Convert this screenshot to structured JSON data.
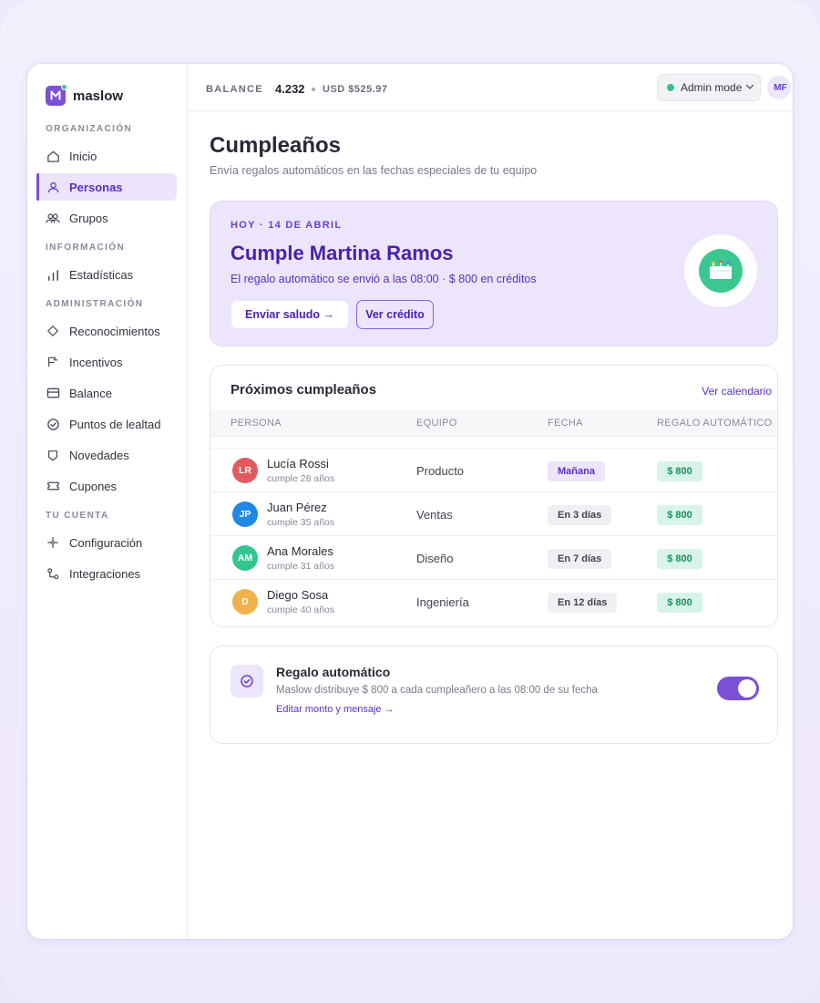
{
  "brand": {
    "name": "maslow",
    "accent": "#7b4fd6"
  },
  "sidebar": {
    "sections": [
      {
        "label": "ORGANIZACIÓN"
      },
      {
        "label": "INFORMACIÓN"
      },
      {
        "label": "ADMINISTRACIÓN"
      },
      {
        "label": "TU CUENTA"
      }
    ],
    "items": [
      {
        "label": "Inicio",
        "icon": "home-icon"
      },
      {
        "label": "Personas",
        "icon": "user-icon",
        "active": true
      },
      {
        "label": "Grupos",
        "icon": "users-icon"
      },
      {
        "label": "Estadísticas",
        "icon": "bar-chart-icon"
      },
      {
        "label": "Reconocimientos",
        "icon": "diamond-icon"
      },
      {
        "label": "Incentivos",
        "icon": "flag-icon"
      },
      {
        "label": "Balance",
        "icon": "card-icon"
      },
      {
        "label": "Puntos de lealtad",
        "icon": "check-circle-icon"
      },
      {
        "label": "Novedades",
        "icon": "shield-icon"
      },
      {
        "label": "Cupones",
        "icon": "ticket-icon"
      },
      {
        "label": "Configuración",
        "icon": "sparkle-icon"
      },
      {
        "label": "Integraciones",
        "icon": "integrations-icon"
      }
    ]
  },
  "topbar": {
    "balance_label": "BALANCE",
    "balance_value": "4.232",
    "balance_usd": "USD $525.97",
    "admin_label": "Admin mode",
    "user_initials": "MF"
  },
  "page": {
    "title": "Cumpleaños",
    "subtitle": "Envía regalos automáticos en las fechas especiales de tu equipo"
  },
  "hero": {
    "date": "HOY · 14 DE ABRIL",
    "title": "Cumple Martina Ramos",
    "desc": "El regalo automático se envió a las 08:00 · $ 800 en créditos",
    "primary_btn": "Enviar saludo →",
    "secondary_btn": "Ver crédito"
  },
  "upcoming": {
    "title": "Próximos cumpleaños",
    "link": "Ver calendario",
    "columns": [
      "PERSONA",
      "EQUIPO",
      "FECHA",
      "REGALO AUTOMÁTICO"
    ],
    "rows": [
      {
        "initials": "LR",
        "color": "#e25a5f",
        "name": "Lucía Rossi",
        "age": "cumple 28 años",
        "team": "Producto",
        "date": "Mañana",
        "gift": "$ 800"
      },
      {
        "initials": "JP",
        "color": "#1f88e5",
        "name": "Juan Pérez",
        "age": "cumple 35 años",
        "team": "Ventas",
        "date": "En 3 días",
        "gift": "$ 800"
      },
      {
        "initials": "AM",
        "color": "#33c590",
        "name": "Ana Morales",
        "age": "cumple 31 años",
        "team": "Diseño",
        "date": "En 7 días",
        "gift": "$ 800"
      },
      {
        "initials": "D",
        "color": "#f0b24a",
        "name": "Diego Sosa",
        "age": "cumple 40 años",
        "team": "Ingeniería",
        "date": "En 12 días",
        "gift": "$ 800"
      }
    ]
  },
  "auto_gift": {
    "title": "Regalo automático",
    "desc": "Maslow distribuye $ 800 a cada cumpleañero a las 08:00 de su fecha",
    "link": "Editar monto y mensaje →",
    "enabled": true
  }
}
